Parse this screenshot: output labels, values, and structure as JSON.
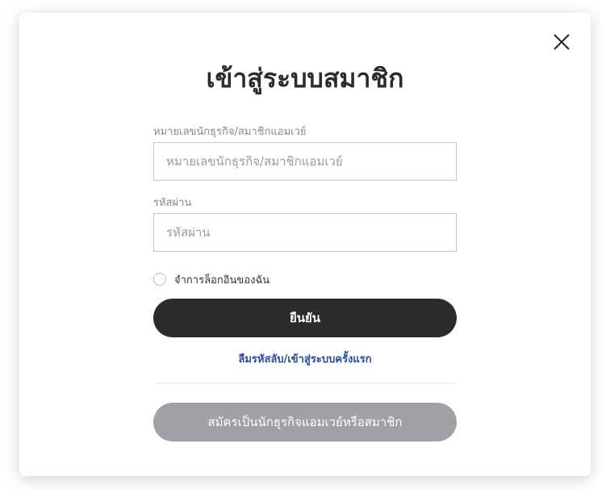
{
  "modal": {
    "title": "เข้าสู่ระบบสมาชิก",
    "close_icon": "close-icon",
    "abo_field": {
      "label": "หมายเลขนักธุรกิจ/สมาชิกแอมเวย์",
      "placeholder": "หมายเลขนักธุรกิจ/สมาชิกแอมเวย์",
      "value": ""
    },
    "password_field": {
      "label": "รหัสผ่าน",
      "placeholder": "รหัสผ่าน",
      "value": ""
    },
    "remember_label": "จำการล็อกอินของฉัน",
    "remember_checked": false,
    "confirm_label": "ยืนยัน",
    "forgot_link": "ลืมรหัสลับ/เข้าสู่ระบบครั้งแรก",
    "register_label": "สมัครเป็นนักธุรกิจแอมเวย์หรือสมาชิก"
  },
  "colors": {
    "primary_button": "#2c2c2c",
    "secondary_button": "#a0a1a5",
    "link": "#2a4a9a"
  }
}
